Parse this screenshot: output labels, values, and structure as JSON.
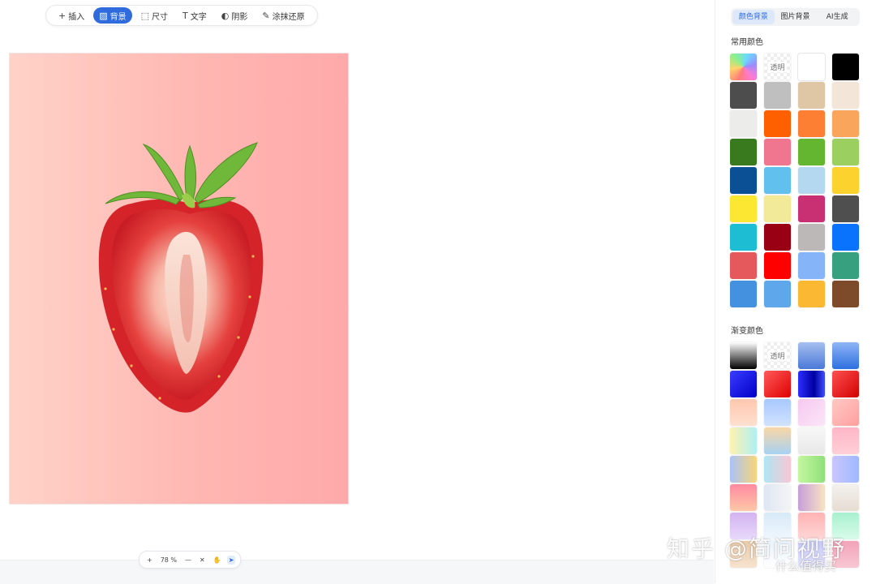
{
  "toolbar": {
    "items": [
      {
        "label": "插入",
        "icon": "plus-icon",
        "glyph": "+"
      },
      {
        "label": "背景",
        "icon": "background-hatch-icon",
        "glyph": "▨"
      },
      {
        "label": "尺寸",
        "icon": "resize-icon",
        "glyph": "⬚"
      },
      {
        "label": "文字",
        "icon": "text-icon",
        "glyph": "T"
      },
      {
        "label": "阴影",
        "icon": "shadow-icon",
        "glyph": "◐"
      },
      {
        "label": "涂抹还原",
        "icon": "brush-restore-icon",
        "glyph": "✎"
      }
    ],
    "active_index": 1,
    "active_color": "#2f6bdc"
  },
  "canvas": {
    "subject": "strawberry-half-image"
  },
  "zoom": {
    "plus": "+",
    "value": "78 %",
    "minus": "—",
    "fit_glyph": "✕",
    "hand_glyph": "✋",
    "pointer_glyph": "➤"
  },
  "panel": {
    "tabs": [
      "颜色背景",
      "图片背景",
      "AI生成"
    ],
    "active_tab": 0,
    "common_title": "常用颜色",
    "transparent_label": "透明",
    "common_colors": [
      "rainbow",
      "transparent",
      "#ffffff",
      "#000000",
      "#4d4d4d",
      "#bfbfbf",
      "#dfc7a5",
      "#f3e6d9",
      "#ececea",
      "#fe6000",
      "#fc7f34",
      "#f9a55b",
      "#3a7a1f",
      "#f0768f",
      "#64b52f",
      "#9bd060",
      "#0b4f94",
      "#62c0ee",
      "#b4d8ef",
      "#fcd22e",
      "#fce832",
      "#f2ea98",
      "#c93074",
      "#4f4f4f",
      "#1dbdd3",
      "#990013",
      "#bdb8b8",
      "#0973fe",
      "#e5585b",
      "#fe0000",
      "#85b5f8",
      "#36a07f",
      "#4492df",
      "#5ea7ea",
      "#fbb832",
      "#7d4a2a"
    ],
    "gradient_title": "渐变颜色",
    "gradient_colors": [
      "linear-gradient(180deg,#ffffff,#000000)",
      "transparent",
      "linear-gradient(180deg,#a7bff0,#4a78d8)",
      "linear-gradient(180deg,#8fb5f5,#2d6fe0)",
      "linear-gradient(135deg,#3a3cff,#0000c8)",
      "linear-gradient(135deg,#ff5a5a,#e00000)",
      "linear-gradient(90deg,#2d2dff,#0000a0 60%,#4050ff)",
      "linear-gradient(135deg,#ff5050,#d10000)",
      "linear-gradient(180deg,#ffc7b0,#ffe0cf)",
      "linear-gradient(180deg,#a8c8ff,#d0e2ff)",
      "linear-gradient(135deg,#f6c8f0,#fbe6f7)",
      "linear-gradient(135deg,#ffc9c4,#ff9f9f)",
      "linear-gradient(90deg,#fff2b0,#aef0f2)",
      "linear-gradient(180deg,#f9d6a6,#a7d2f3)",
      "linear-gradient(180deg,#f7f7f7,#e8e8e8)",
      "linear-gradient(180deg,#ffb6c6,#ffcfd8)",
      "linear-gradient(90deg,#a9c2f7,#f7d67a)",
      "linear-gradient(90deg,#aee7f2,#f9c6d4)",
      "linear-gradient(90deg,#c4f7a0,#8fe07a)",
      "linear-gradient(90deg,#c9c6ff,#9fb9ff)",
      "linear-gradient(180deg,#ff8aa0,#ffc8a8)",
      "linear-gradient(90deg,#dfe6f3,#f4f4f4)",
      "linear-gradient(90deg,#c89ed8,#f7e3c2)",
      "linear-gradient(180deg,#f3f1ee,#e6ddd2)",
      "linear-gradient(180deg,#d2b3f0,#e8d9fb)",
      "linear-gradient(180deg,#d7e9f7,#f0f7fd)",
      "linear-gradient(180deg,#ffb3b3,#ffd6d6)",
      "linear-gradient(180deg,#a8f0cf,#d9fbea)",
      "linear-gradient(180deg,#e8c9a8,#f6e3cf)",
      "linear-gradient(180deg,#e9f3fb,#ffffff)",
      "linear-gradient(180deg,#c7c9f7,#e3e4fb)",
      "linear-gradient(180deg,#f2a3b8,#f8c7d3)"
    ]
  },
  "watermark": {
    "main": "知乎 @简问视野",
    "sub": "什么值得买"
  }
}
